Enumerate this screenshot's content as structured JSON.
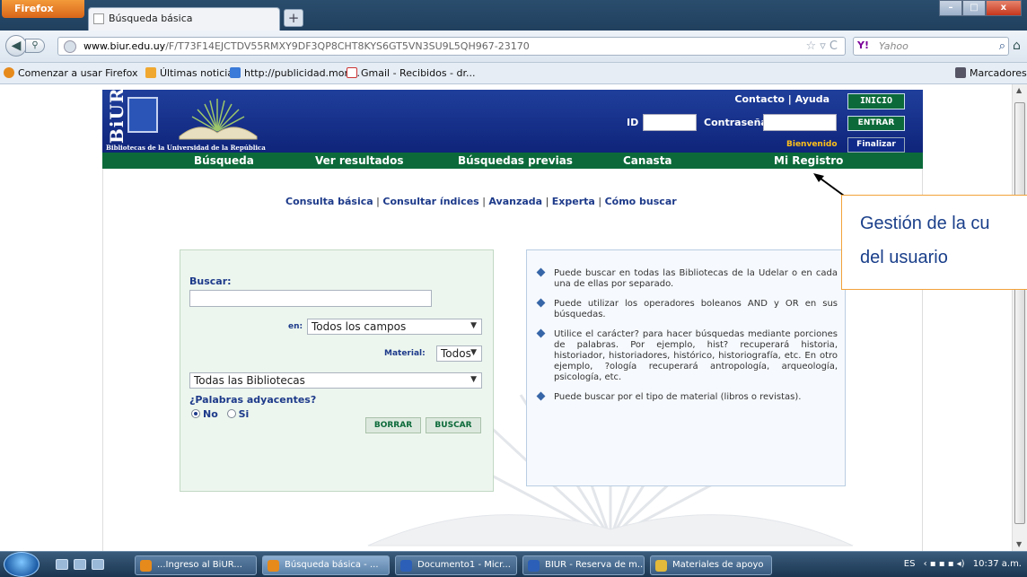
{
  "browser": {
    "menu_button": "Firefox",
    "tab_title": "Búsqueda básica",
    "new_tab": "+",
    "url_domain": "www.biur.edu.uy",
    "url_path": "/F/T73F14EJCTDV55RMXY9DF3QP8CHT8KYS6GT5VN3SU9L5QH967-23170",
    "search_engine_label": "Yahoo",
    "bookmarks": [
      "Comenzar a usar Firefox",
      "Últimas noticias",
      "http://publicidad.mon...",
      "Gmail - Recibidos - dr..."
    ],
    "bookmarks_menu": "Marcadores"
  },
  "header": {
    "logo_text": "BiUR",
    "logo_subtitle": "Bibliotecas de la Universidad de la República",
    "top_links": "Contacto | Ayuda",
    "inicio": "INICIO",
    "id_label": "ID",
    "password_label": "Contraseña",
    "entrar": "ENTRAR",
    "bienvenido": "Bienvenido",
    "finalizar": "Finalizar"
  },
  "main_nav": {
    "items": [
      "Búsqueda",
      "Ver resultados",
      "Búsquedas previas",
      "Canasta",
      "Mi Registro"
    ]
  },
  "subnav": {
    "items": [
      "Consulta básica",
      "Consultar índices",
      "Avanzada",
      "Experta",
      "Cómo buscar"
    ],
    "separator": " | "
  },
  "search_form": {
    "buscar_label": "Buscar:",
    "buscar_value": "",
    "en_label": "en:",
    "en_value": "Todos los campos",
    "material_label": "Material:",
    "material_value": "Todos",
    "library_value": "Todas las Bibliotecas",
    "adjacent_label": "¿Palabras adyacentes?",
    "option_no": "No",
    "option_si": "Si",
    "borrar": "BORRAR",
    "buscar_btn": "BUSCAR"
  },
  "help_text": {
    "items": [
      "Puede buscar en todas las Bibliotecas de la Udelar o en cada una de ellas por separado.",
      "Puede utilizar los operadores boleanos AND y OR en sus búsquedas.",
      "Utilice el carácter? para hacer búsquedas mediante porciones de palabras. Por ejemplo, hist? recuperará historia, historiador, historiadores, histórico, historiografía, etc. En otro ejemplo, ?ología recuperará antropología, arqueología, psicología, etc.",
      "Puede buscar por el tipo de material (libros o revistas)."
    ]
  },
  "callout": {
    "line1": "Gestión de la cu",
    "line2": "del usuario"
  },
  "taskbar": {
    "items": [
      "...Ingreso al BiUR...",
      "Búsqueda básica - ...",
      "Documento1 - Micr...",
      "BIUR - Reserva de m...",
      "Materiales de apoyo"
    ],
    "language": "ES",
    "clock": "10:37 a.m."
  },
  "colors": {
    "header_blue": "#14318a",
    "nav_green": "#0c6a3a",
    "accent_orange": "#f2a23a",
    "bienvenido_yellow": "#ffbf1a"
  }
}
